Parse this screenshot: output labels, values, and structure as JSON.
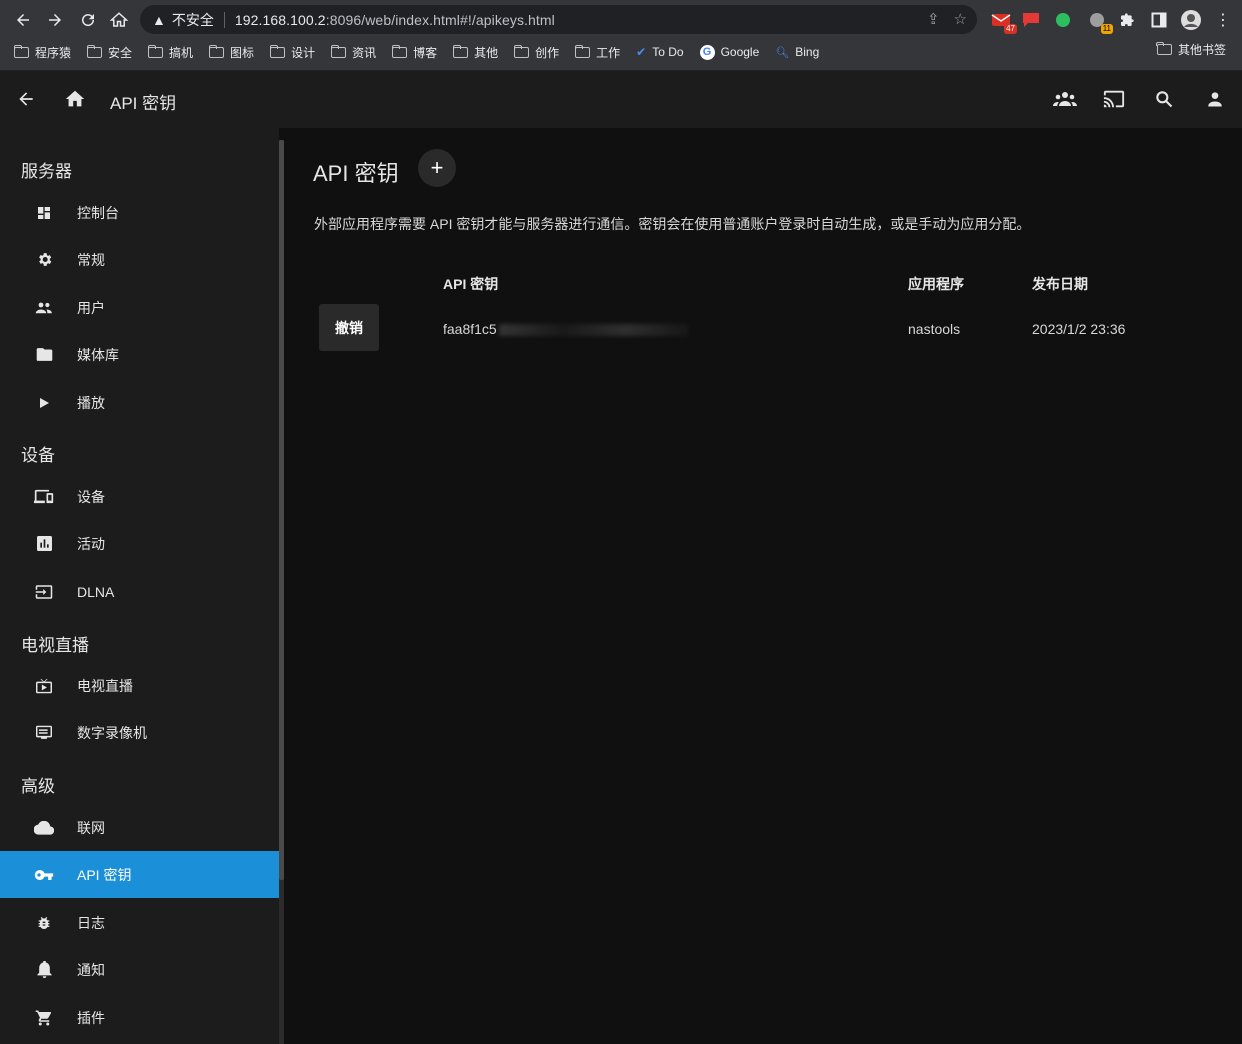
{
  "browser": {
    "url_insecure_label": "不安全",
    "url_host": "192.168.100.2",
    "url_rest": ":8096/web/index.html#!/apikeys.html",
    "ext_badges": [
      "47",
      "11"
    ],
    "bookmarks": [
      "程序猿",
      "安全",
      "搞机",
      "图标",
      "设计",
      "资讯",
      "博客",
      "其他",
      "创作",
      "工作",
      "To Do",
      "Google",
      "Bing"
    ],
    "other_bookmarks": "其他书签"
  },
  "header": {
    "title": "API 密钥"
  },
  "sidebar": {
    "sections": [
      {
        "title": "服务器",
        "items": [
          {
            "label": "控制台",
            "icon": "dashboard-icon"
          },
          {
            "label": "常规",
            "icon": "gear-icon"
          },
          {
            "label": "用户",
            "icon": "users-icon"
          },
          {
            "label": "媒体库",
            "icon": "folder-icon"
          },
          {
            "label": "播放",
            "icon": "play-icon"
          }
        ]
      },
      {
        "title": "设备",
        "items": [
          {
            "label": "设备",
            "icon": "devices-icon"
          },
          {
            "label": "活动",
            "icon": "chart-icon"
          },
          {
            "label": "DLNA",
            "icon": "input-icon"
          }
        ]
      },
      {
        "title": "电视直播",
        "items": [
          {
            "label": "电视直播",
            "icon": "live-tv-icon"
          },
          {
            "label": "数字录像机",
            "icon": "dvr-icon"
          }
        ]
      },
      {
        "title": "高级",
        "items": [
          {
            "label": "联网",
            "icon": "cloud-icon"
          },
          {
            "label": "API 密钥",
            "icon": "key-icon",
            "active": true
          },
          {
            "label": "日志",
            "icon": "bug-icon"
          },
          {
            "label": "通知",
            "icon": "bell-icon"
          },
          {
            "label": "插件",
            "icon": "cart-icon"
          }
        ]
      }
    ]
  },
  "main": {
    "title": "API 密钥",
    "add_label": "+",
    "description": "外部应用程序需要 API 密钥才能与服务器进行通信。密钥会在使用普通账户登录时自动生成，或是手动为应用分配。",
    "columns": [
      "API 密钥",
      "应用程序",
      "发布日期"
    ],
    "rows": [
      {
        "revoke_label": "撤销",
        "key_visible": "faa8f1c5",
        "app": "nastools",
        "date": "2023/1/2 23:36"
      }
    ]
  },
  "colors": {
    "accent": "#1b8fd8",
    "sidebar_bg": "#1c1c1c",
    "main_bg": "#101010"
  }
}
